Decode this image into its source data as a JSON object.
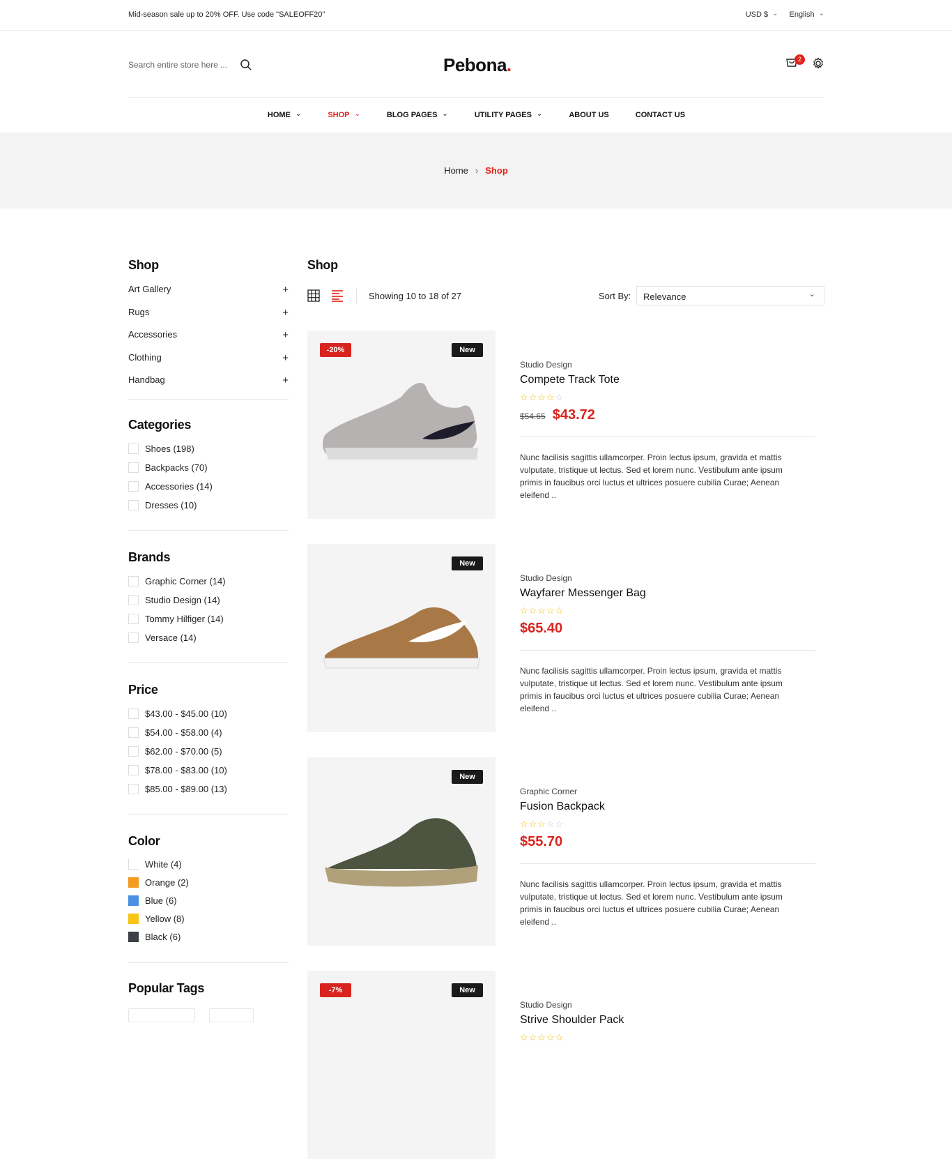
{
  "topbar": {
    "promo": "Mid-season sale up to 20% OFF. Use code \"SALEOFF20\"",
    "currency": "USD $",
    "language": "English"
  },
  "header": {
    "search_placeholder": "Search entire store here ...",
    "logo": "Pebona",
    "logo_dot": ".",
    "cart_count": "2"
  },
  "nav": {
    "items": [
      "HOME",
      "SHOP",
      "BLOG PAGES",
      "UTILITY PAGES",
      "ABOUT US",
      "CONTACT US"
    ],
    "active": "SHOP"
  },
  "breadcrumb": {
    "home": "Home",
    "current": "Shop"
  },
  "sidebar": {
    "shop_title": "Shop",
    "shop_items": [
      "Art Gallery",
      "Rugs",
      "Accessories",
      "Clothing",
      "Handbag"
    ],
    "categories_title": "Categories",
    "categories": [
      "Shoes (198)",
      "Backpacks (70)",
      "Accessories (14)",
      "Dresses (10)"
    ],
    "brands_title": "Brands",
    "brands": [
      "Graphic Corner (14)",
      "Studio Design (14)",
      "Tommy Hilfiger (14)",
      "Versace (14)"
    ],
    "price_title": "Price",
    "prices": [
      "$43.00 - $45.00 (10)",
      "$54.00 - $58.00 (4)",
      "$62.00 - $70.00 (5)",
      "$78.00 - $83.00 (10)",
      "$85.00 - $89.00 (13)"
    ],
    "color_title": "Color",
    "colors": [
      {
        "label": "White (4)",
        "hex": "#ffffff"
      },
      {
        "label": "Orange (2)",
        "hex": "#f39c1f"
      },
      {
        "label": "Blue (6)",
        "hex": "#4a90e2"
      },
      {
        "label": "Yellow (8)",
        "hex": "#f5c518"
      },
      {
        "label": "Black (6)",
        "hex": "#3c4046"
      }
    ],
    "tags_title": "Popular Tags"
  },
  "main": {
    "title": "Shop",
    "showing": "Showing 10 to 18 of 27",
    "sort_label": "Sort By:",
    "sort_value": "Relevance"
  },
  "products": [
    {
      "sale_tag": "-20%",
      "new_tag": "New",
      "brand": "Studio Design",
      "name": "Compete Track Tote",
      "rating": 4,
      "old_price": "$54.65",
      "price": "$43.72",
      "description": "Nunc facilisis sagittis ullamcorper. Proin lectus ipsum, gravida et mattis vulputate, tristique ut lectus. Sed et lorem nunc. Vestibulum ante ipsum primis in faucibus orci luctus et ultrices posuere cubilia Curae; Aenean eleifend .."
    },
    {
      "sale_tag": "",
      "new_tag": "New",
      "brand": "Studio Design",
      "name": "Wayfarer Messenger Bag",
      "rating": 0,
      "old_price": "",
      "price": "$65.40",
      "description": "Nunc facilisis sagittis ullamcorper. Proin lectus ipsum, gravida et mattis vulputate, tristique ut lectus. Sed et lorem nunc. Vestibulum ante ipsum primis in faucibus orci luctus et ultrices posuere cubilia Curae; Aenean eleifend .."
    },
    {
      "sale_tag": "",
      "new_tag": "New",
      "brand": "Graphic Corner",
      "name": "Fusion Backpack",
      "rating": 3,
      "old_price": "",
      "price": "$55.70",
      "description": "Nunc facilisis sagittis ullamcorper. Proin lectus ipsum, gravida et mattis vulputate, tristique ut lectus. Sed et lorem nunc. Vestibulum ante ipsum primis in faucibus orci luctus et ultrices posuere cubilia Curae; Aenean eleifend .."
    },
    {
      "sale_tag": "-7%",
      "new_tag": "New",
      "brand": "Studio Design",
      "name": "Strive Shoulder Pack",
      "rating": 0,
      "old_price": "",
      "price": "",
      "description": ""
    }
  ],
  "colors": {
    "accent": "#e2231a",
    "dark": "#111111"
  }
}
